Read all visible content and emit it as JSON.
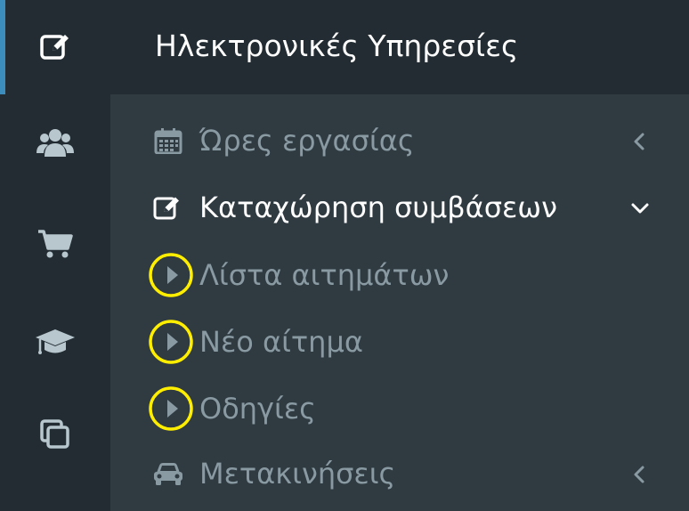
{
  "header": {
    "title": "Ηλεκτρονικές Υπηρεσίες",
    "icon": "edit-icon"
  },
  "rail": {
    "icons": [
      "users-icon",
      "shopping-cart-icon",
      "graduation-cap-icon",
      "clone-icon"
    ]
  },
  "menu": {
    "items": [
      {
        "label": "Ώρες εργασίας",
        "icon": "calendar-icon",
        "chevron": "chevron-left-icon",
        "state": "collapsed"
      },
      {
        "label": "Καταχώρηση συμβάσεων",
        "icon": "edit-icon",
        "chevron": "chevron-down-icon",
        "state": "expanded"
      },
      {
        "label": "Μετακινήσεις",
        "icon": "car-icon",
        "chevron": "chevron-left-icon",
        "state": "collapsed"
      }
    ],
    "subitems": [
      {
        "label": "Λίστα αιτημάτων",
        "icon": "caret-right-icon"
      },
      {
        "label": "Νέο αίτημα",
        "icon": "caret-right-icon"
      },
      {
        "label": "Οδηγίες",
        "icon": "caret-right-icon"
      }
    ]
  },
  "colors": {
    "header_bg": "#222c32",
    "menu_bg": "#2f3a41",
    "accent": "#3c8dbc",
    "muted_text": "#8a9aa3",
    "active_text": "#ffffff",
    "highlight_circle": "#ffee00"
  }
}
